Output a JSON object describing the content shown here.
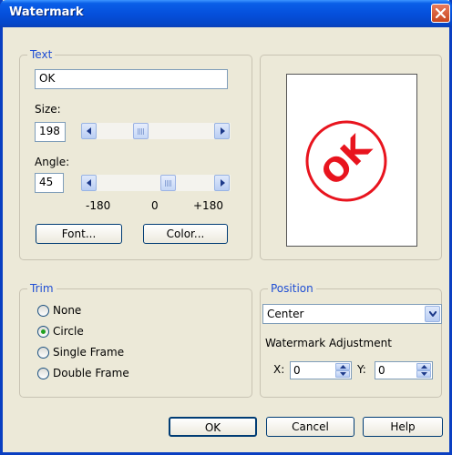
{
  "window": {
    "title": "Watermark"
  },
  "text_group": {
    "legend": "Text",
    "text_value": "OK",
    "size_label": "Size:",
    "size_value": "198",
    "angle_label": "Angle:",
    "angle_value": "45",
    "angle_slider": {
      "min": -180,
      "max": 180,
      "value": 45
    },
    "size_slider": {
      "value": 198
    },
    "scale": {
      "min_label": "-180",
      "mid_label": "0",
      "max_label": "+180"
    },
    "font_button": "Font...",
    "color_button": "Color..."
  },
  "preview": {
    "watermark_text": "OK",
    "watermark_color": "#e8141e",
    "trim": "circle",
    "angle": 45
  },
  "trim_group": {
    "legend": "Trim",
    "options": [
      {
        "label": "None",
        "checked": false
      },
      {
        "label": "Circle",
        "checked": true
      },
      {
        "label": "Single Frame",
        "checked": false
      },
      {
        "label": "Double Frame",
        "checked": false
      }
    ]
  },
  "position_group": {
    "legend": "Position",
    "selected": "Center",
    "adjustment_label": "Watermark Adjustment",
    "x_label": "X:",
    "x_value": "0",
    "y_label": "Y:",
    "y_value": "0"
  },
  "buttons": {
    "ok": "OK",
    "cancel": "Cancel",
    "help": "Help"
  },
  "colors": {
    "title_bar": "#0550dc",
    "legend_text": "#1f4ed4",
    "radio_dot": "#21a121",
    "close_button": "#c9461f"
  }
}
